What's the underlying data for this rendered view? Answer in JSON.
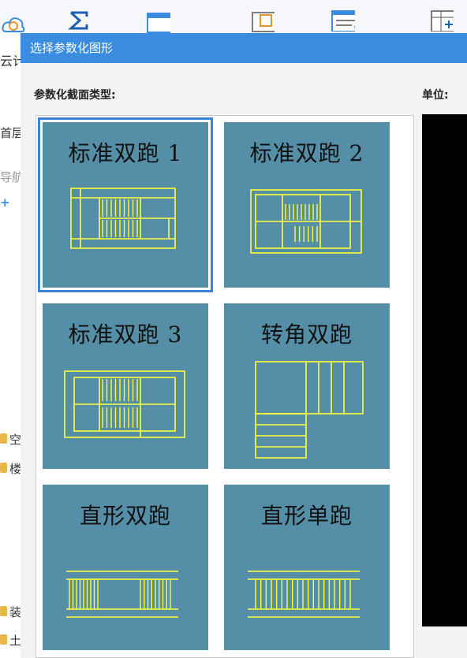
{
  "background_app": {
    "fragments": [
      "云计",
      "首层",
      "导航",
      "+",
      "空",
      "楼",
      "装",
      "土"
    ]
  },
  "dialog": {
    "title": "选择参数化图形",
    "section_label": "参数化截面类型:",
    "unit_label": "单位:",
    "shapes": [
      {
        "label": "标准双跑 1",
        "selected": true
      },
      {
        "label": "标准双跑 2",
        "selected": false
      },
      {
        "label": "标准双跑 3",
        "selected": false
      },
      {
        "label": "转角双跑",
        "selected": false
      },
      {
        "label": "直形双跑",
        "selected": false
      },
      {
        "label": "直形单跑",
        "selected": false
      }
    ]
  },
  "colors": {
    "title_bar": "#3a8ce0",
    "thumbnail_bg": "#558ea7",
    "line": "#ffff33",
    "selection": "#3c82d6"
  }
}
